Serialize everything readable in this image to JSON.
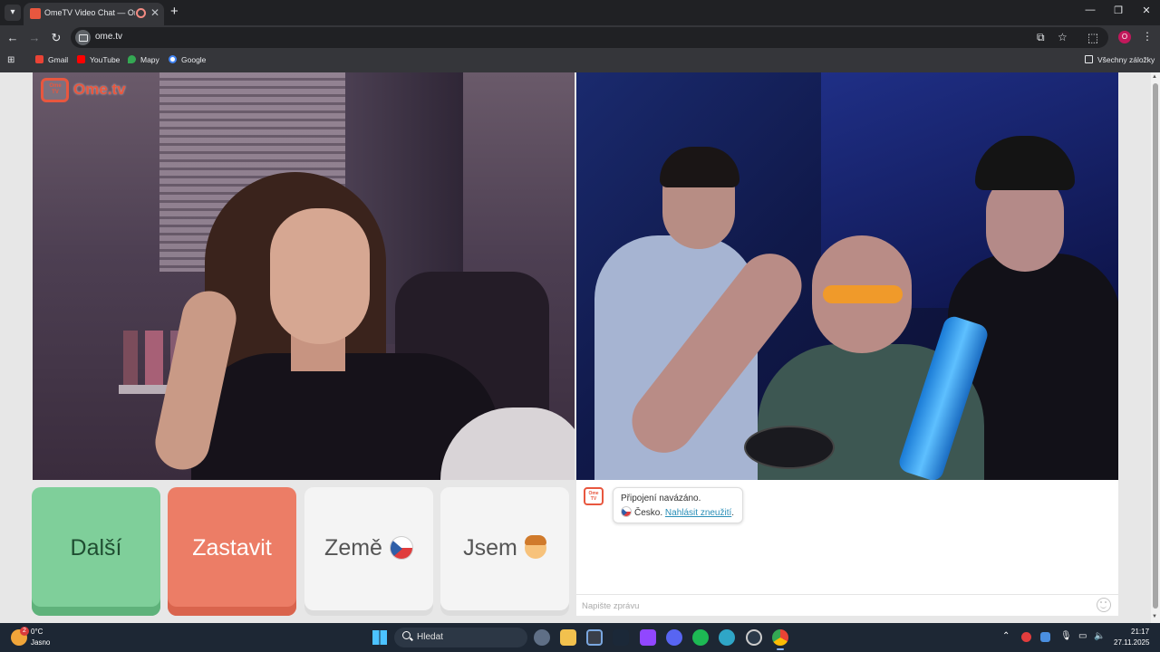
{
  "browser": {
    "tab": {
      "title": "OmeTV Video Chat — Ome",
      "close": "✕"
    },
    "new_tab": "+",
    "window_controls": {
      "minimize": "—",
      "maximize": "❐",
      "close": "✕"
    },
    "url": "ome.tv",
    "profile_initial": "O",
    "bookmarks": [
      "Gmail",
      "YouTube",
      "Mapy",
      "Google"
    ],
    "all_bookmarks": "Všechny záložky"
  },
  "logo": {
    "tv_text": "Ome TV",
    "text": "Ome.tv"
  },
  "buttons": {
    "next": "Další",
    "stop": "Zastavit",
    "country": "Země",
    "me": "Jsem"
  },
  "chat": {
    "avatar_text": "Ome TV",
    "status": "Připojení navázáno.",
    "country": "Česko.",
    "report_link": "Nahlásit zneužití",
    "after_link": ".",
    "input_placeholder": "Napište zprávu"
  },
  "taskbar": {
    "weather_badge": "2",
    "temperature": "0°C",
    "weather_desc": "Jasno",
    "search_label": "Hledat",
    "time": "21:17",
    "date": "27.11.2025"
  },
  "colors": {
    "brand": "#e8573f",
    "next_button": "#7fcf9a",
    "stop_button": "#ec7d66",
    "link": "#2a8fb8"
  },
  "icons": [
    "tab-list-icon",
    "back-icon",
    "forward-icon",
    "reload-icon",
    "cast-icon",
    "star-icon",
    "extensions-icon",
    "menu-icon",
    "apps-icon",
    "folder-icon",
    "smiley-icon",
    "search-icon",
    "windows-start-icon"
  ]
}
